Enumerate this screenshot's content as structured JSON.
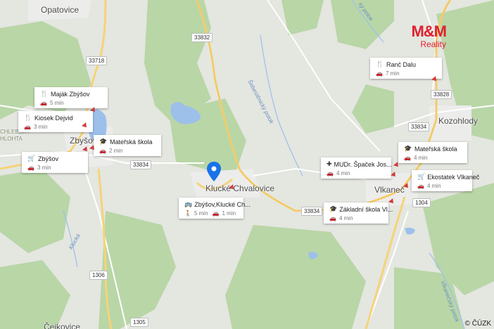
{
  "places": {
    "opatovice": "Opatovice",
    "zbysov": "Zbyšov",
    "klucke_chvalovice": "Klucké Chvalovice",
    "vlkanec": "Vlkaneč",
    "kozohlody": "Kozohlody",
    "cejkovice": "Čejkovice",
    "chlebsky_hlohta": "CHLEBSKÝ HLOHTA"
  },
  "roads": [
    "33832",
    "33718",
    "33834",
    "33834",
    "33834",
    "33828",
    "1304",
    "1306",
    "1305"
  ],
  "water": {
    "sebestenicky_potok": "Šebestěnický potok",
    "vlkanecky_potok": "Vlkanečský potok",
    "klucka": "Klucká",
    "krasnonsky_potok": "ký potok"
  },
  "pois": [
    {
      "name": "Maják Zbýšov",
      "icon": "fork-knife-icon",
      "glyph": "🍴",
      "mode": "car-icon",
      "duration": "5 min"
    },
    {
      "name": "Kiosek Dejvid",
      "icon": "fork-knife-icon",
      "glyph": "🍴",
      "mode": "car-icon",
      "duration": "3 min"
    },
    {
      "name": "Mateřská škola",
      "icon": "school-icon",
      "glyph": "🎓",
      "mode": "car-icon",
      "duration": "2 min"
    },
    {
      "name": "Zbýšov",
      "icon": "cart-icon",
      "glyph": "🛒",
      "mode": "car-icon",
      "duration": "3 min"
    },
    {
      "name": "Zbýšov,Klucké Ch...",
      "icon": "bus-icon",
      "glyph": "🚌",
      "mode": "walk-icon",
      "duration": "5 min",
      "mode2": "car-icon",
      "duration2": "1 min"
    },
    {
      "name": "Ranč Dalu",
      "icon": "fork-knife-icon",
      "glyph": "🍴",
      "mode": "car-icon",
      "duration": "7 min"
    },
    {
      "name": "Mateřská škola",
      "icon": "school-icon",
      "glyph": "🎓",
      "mode": "car-icon",
      "duration": "4 min"
    },
    {
      "name": "MUDr. Špaček Jos...",
      "icon": "medical-icon",
      "glyph": "✚",
      "mode": "car-icon",
      "duration": "4 min"
    },
    {
      "name": "Ekostatek Vlkaneč",
      "icon": "cart-icon",
      "glyph": "🛒",
      "mode": "car-icon",
      "duration": "4 min"
    },
    {
      "name": "Základní škola Vl...",
      "icon": "school-icon",
      "glyph": "🎓",
      "mode": "car-icon",
      "duration": "4 min"
    }
  ],
  "logo": {
    "brand": "M&M",
    "sub": "Reality",
    "color": "#e0202e"
  },
  "copyright": "© ČÚZK",
  "colors": {
    "forest": "#b9d6a7",
    "field": "#e4e6e0",
    "water": "#9cc0ea",
    "road_yellow": "#f6d377",
    "pin": "#1a73e8"
  }
}
